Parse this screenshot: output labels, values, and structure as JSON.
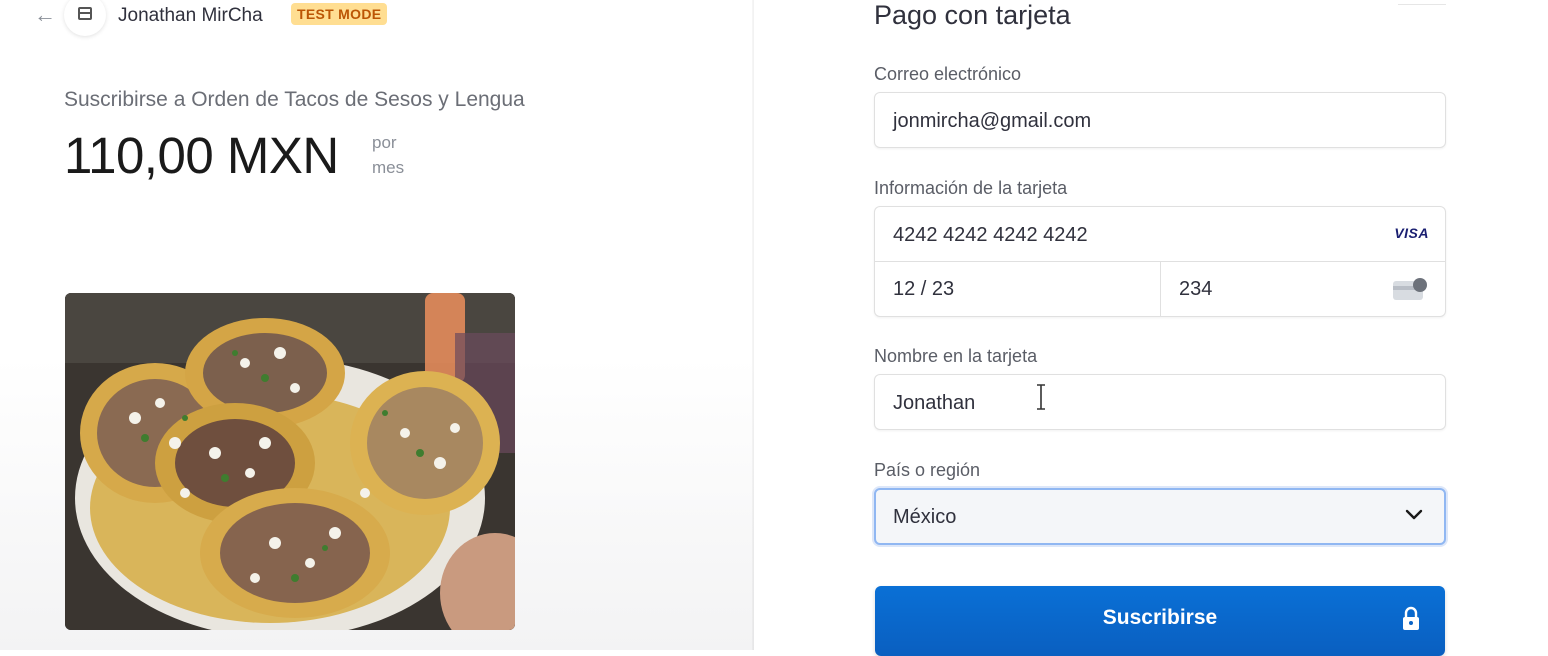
{
  "header": {
    "merchant_name": "Jonathan MirCha",
    "test_mode_badge": "TEST MODE",
    "back_icon": "back-arrow-icon",
    "store_icon": "store-icon"
  },
  "summary": {
    "product_line": "Suscribirse a Orden de Tacos de Sesos y Lengua",
    "price": "110,00 MXN",
    "interval_line1": "por",
    "interval_line2": "mes",
    "image": "tacos-photo"
  },
  "form": {
    "title": "Pago con tarjeta",
    "email_label": "Correo electrónico",
    "email_value": "jonmircha@gmail.com",
    "card_label": "Información de la tarjeta",
    "card_number": "4242 4242 4242 4242",
    "card_brand": "VISA",
    "expiry": "12 / 23",
    "cvc": "234",
    "cvc_icon": "cvc-card-icon",
    "name_label": "Nombre en la tarjeta",
    "name_value": "Jonathan",
    "country_label": "País o región",
    "country_value": "México",
    "submit_label": "Suscribirse",
    "submit_icon": "lock-icon"
  },
  "colors": {
    "accent": "#0a68d0",
    "badge_bg": "#ffde92",
    "badge_text": "#bb5504",
    "focus_border": "#90b7f2"
  }
}
